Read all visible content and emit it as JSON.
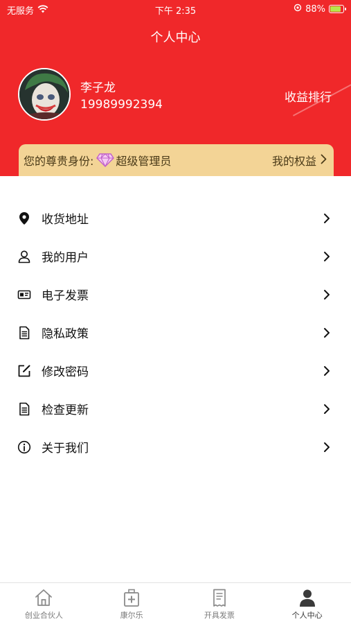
{
  "status_bar": {
    "carrier": "无服务",
    "time": "下午 2:35",
    "battery": "88%",
    "battery_level": 0.88
  },
  "header": {
    "title": "个人中心",
    "user_name": "李子龙",
    "phone": "19989992394",
    "rank_link": "收益排行"
  },
  "vip": {
    "label": "您的尊贵身份:",
    "role": "超级管理员",
    "rights": "我的权益"
  },
  "menu": [
    {
      "label": "收货地址",
      "icon": "location-pin-icon"
    },
    {
      "label": "我的用户",
      "icon": "user-outline-icon"
    },
    {
      "label": "电子发票",
      "icon": "id-card-icon"
    },
    {
      "label": "隐私政策",
      "icon": "document-icon"
    },
    {
      "label": "修改密码",
      "icon": "edit-icon"
    },
    {
      "label": "检查更新",
      "icon": "document-icon"
    },
    {
      "label": "关于我们",
      "icon": "info-circle-icon"
    }
  ],
  "tabs": [
    {
      "label": "创业合伙人",
      "icon": "house-icon",
      "active": false
    },
    {
      "label": "康尔乐",
      "icon": "medkit-icon",
      "active": false
    },
    {
      "label": "开具发票",
      "icon": "receipt-icon",
      "active": false
    },
    {
      "label": "个人中心",
      "icon": "person-icon",
      "active": true
    }
  ],
  "colors": {
    "header_bg": "#f0282a",
    "vip_bg": "#f3d496",
    "gem": "#c060c8"
  }
}
